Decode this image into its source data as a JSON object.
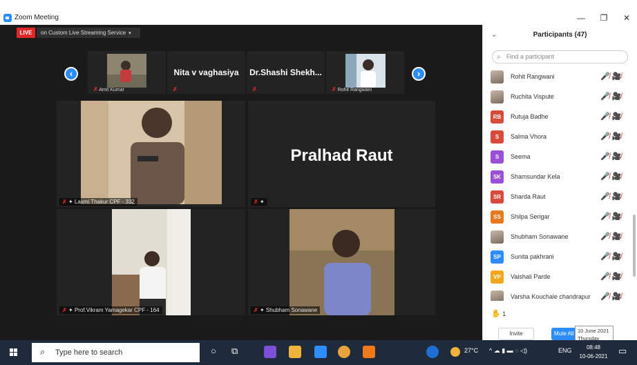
{
  "window": {
    "title": "Zoom Meeting",
    "controls": {
      "minimize": "—",
      "maximize": "❐",
      "close": "✕"
    }
  },
  "toolbar": {
    "live_label": "LIVE",
    "stream_label": "on Custom Live Streaming Service",
    "stream_caret": "▾"
  },
  "strip": {
    "prev_icon": "‹",
    "next_icon": "›",
    "tiles": [
      {
        "small_name": "Amit Kumar"
      },
      {
        "big_name": "Nita v vaghasiya"
      },
      {
        "big_name": "Dr.Shashi  Shekh..."
      },
      {
        "small_name": "Rohit Rangwani"
      }
    ],
    "mute_glyph": "✗"
  },
  "gallery": {
    "tiles": [
      {
        "name": "Laxmi Thakur CPF - 332"
      },
      {
        "big_name": "Pralhad Raut"
      },
      {
        "name": "Prof.Vikram Yamagekar CPF - 164"
      },
      {
        "name": "Shubham Sonawane"
      }
    ]
  },
  "participants": {
    "title": "Participants (47)",
    "collapse_icon": "⌄",
    "search_placeholder": "Find a participant",
    "search_icon": "⌕",
    "mic_video_icons": "🎤̸ 🎥̸",
    "list": [
      {
        "name": "Rohit Rangwani",
        "initials": "",
        "color": "",
        "photo": true
      },
      {
        "name": "Ruchita Vispute",
        "initials": "",
        "color": "",
        "photo": true
      },
      {
        "name": "Rutuja Badhe",
        "initials": "RB",
        "color": "#d84a3a",
        "photo": false
      },
      {
        "name": "Salma Vhora",
        "initials": "S",
        "color": "#d84a3a",
        "photo": false
      },
      {
        "name": "Seema",
        "initials": "S",
        "color": "#9b4fd6",
        "photo": false
      },
      {
        "name": "Shamsundar Kela",
        "initials": "SK",
        "color": "#9b4fd6",
        "photo": false
      },
      {
        "name": "Sharda Raut",
        "initials": "SR",
        "color": "#d84a3a",
        "photo": false
      },
      {
        "name": "Shilpa Serigar",
        "initials": "SS",
        "color": "#e8781e",
        "photo": false
      },
      {
        "name": "Shubham Sonawane",
        "initials": "",
        "color": "",
        "photo": true
      },
      {
        "name": "Sunita pakhrani",
        "initials": "SP",
        "color": "#2d8cff",
        "photo": false
      },
      {
        "name": "Vaishali Parde",
        "initials": "VP",
        "color": "#f2a71b",
        "photo": false
      },
      {
        "name": "Varsha Kouchale chandrapur",
        "initials": "",
        "color": "",
        "photo": true
      }
    ],
    "raised_hands": "1",
    "hand_icon": "✋",
    "invite_label": "Invite",
    "mute_all_label": "Mute All",
    "tooltip_date": "10 June 2021",
    "tooltip_day": "Thursday"
  },
  "taskbar": {
    "search_placeholder": "Type here to search",
    "search_icon": "⌕",
    "temperature": "27°C",
    "language": "ENG",
    "time": "08:48",
    "date": "10-06-2021",
    "cortana_icon": "○",
    "taskview_icon": "⧉",
    "tray_icons": "^ ☁ ▮ ▬ ◌ ◁) ",
    "notification_icon": "▭"
  }
}
